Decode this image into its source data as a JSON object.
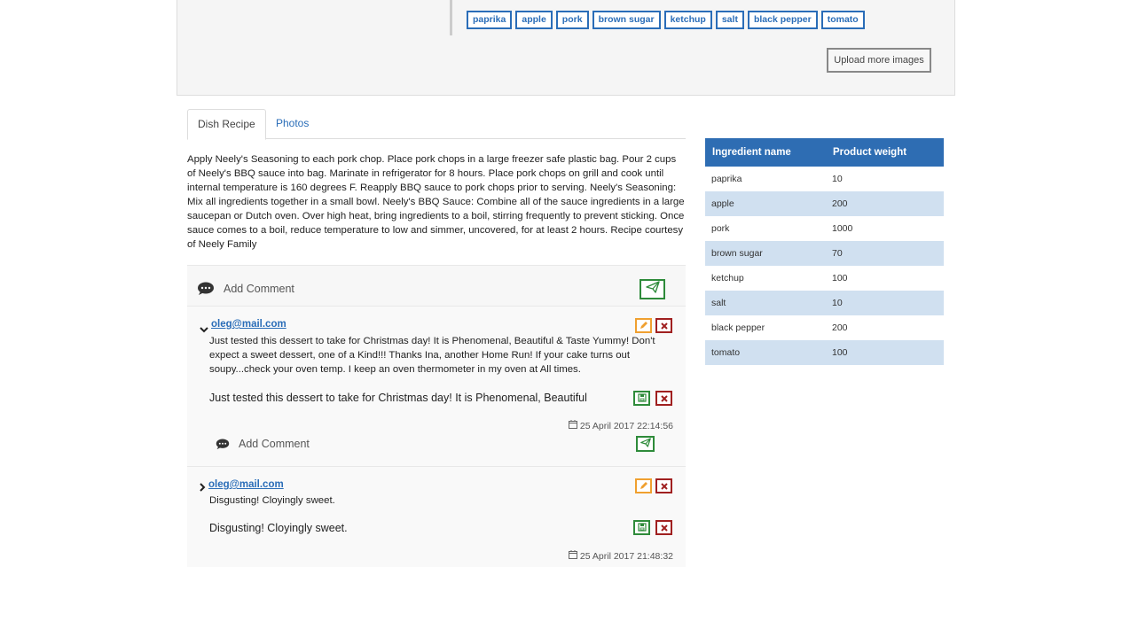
{
  "tags": [
    "paprika",
    "apple",
    "pork",
    "brown sugar",
    "ketchup",
    "salt",
    "black pepper",
    "tomato"
  ],
  "upload_label": "Upload more images",
  "tabs": {
    "recipe": "Dish Recipe",
    "photos": "Photos"
  },
  "recipe_text": "Apply Neely's Seasoning to each pork chop. Place pork chops in a large freezer safe plastic bag. Pour 2 cups of Neely's BBQ sauce into bag. Marinate in refrigerator for 8 hours. Place pork chops on grill and cook until internal temperature is 160 degrees F. Reapply BBQ sauce to pork chops prior to serving. Neely's Seasoning: Mix all ingredients together in a small bowl. Neely's BBQ Sauce: Combine all of the sauce ingredients in a large saucepan or Dutch oven. Over high heat, bring ingredients to a boil, stirring frequently to prevent sticking. Once sauce comes to a boil, reduce temperature to low and simmer, uncovered, for at least 2 hours. Recipe courtesy of Neely Family",
  "add_comment_label": "Add Comment",
  "comments": [
    {
      "author": "oleg@mail.com",
      "text": "Just tested this dessert to take for Christmas day! It is Phenomenal, Beautiful & Taste Yummy! Don't expect a sweet dessert, one of a Kind!!! Thanks Ina, another Home Run! If your cake turns out soupy...check your oven temp. I keep an oven thermometer in my oven at All times.",
      "edit_value": "Just tested this dessert to take for Christmas day! It is Phenomenal, Beautiful",
      "date": "25 April 2017 22:14:56",
      "reply_label": "Add Comment"
    },
    {
      "author": "oleg@mail.com",
      "text": "Disgusting! Cloyingly sweet.",
      "edit_value": "Disgusting! Cloyingly sweet.",
      "date": "25 April 2017 21:48:32"
    }
  ],
  "ingredients": {
    "headers": [
      "Ingredient name",
      "Product weight"
    ],
    "rows": [
      [
        "paprika",
        "10"
      ],
      [
        "apple",
        "200"
      ],
      [
        "pork",
        "1000"
      ],
      [
        "brown sugar",
        "70"
      ],
      [
        "ketchup",
        "100"
      ],
      [
        "salt",
        "10"
      ],
      [
        "black pepper",
        "200"
      ],
      [
        "tomato",
        "100"
      ]
    ]
  },
  "colors": {
    "accent": "#2a6db8",
    "table_header": "#2e6db3",
    "row_alt": "#d0e0f0",
    "save_green": "#2e8b3a",
    "edit_orange": "#f0a030",
    "delete_red": "#a02020"
  }
}
